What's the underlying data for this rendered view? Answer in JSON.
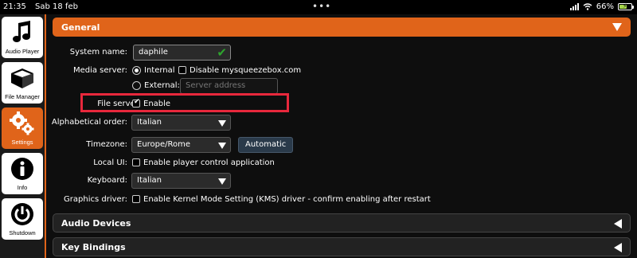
{
  "status": {
    "time": "21:35",
    "date": "Sab 18 feb",
    "battery": "66%",
    "battery_level": 0.66
  },
  "sidebar": {
    "items": [
      {
        "label": "Audio Player",
        "icon": "music-note-icon",
        "active": false
      },
      {
        "label": "File Manager",
        "icon": "drive-box-icon",
        "active": false
      },
      {
        "label": "Settings",
        "icon": "gears-icon",
        "active": true
      },
      {
        "label": "Info",
        "icon": "info-icon",
        "active": false
      },
      {
        "label": "Shutdown",
        "icon": "power-icon",
        "active": false
      }
    ]
  },
  "general": {
    "title": "General",
    "system_name_label": "System name:",
    "system_name_value": "daphile",
    "media_server_label": "Media server:",
    "internal_label": "Internal",
    "disable_mysqueezebox_label": "Disable mysqueezebox.com",
    "external_label": "External:",
    "server_address_placeholder": "Server address",
    "file_server_label": "File server:",
    "file_server_enable_label": "Enable",
    "alphabetical_order_label": "Alphabetical order:",
    "alphabetical_order_value": "Italian",
    "timezone_label": "Timezone:",
    "timezone_value": "Europe/Rome",
    "automatic_button": "Automatic",
    "local_ui_label": "Local UI:",
    "local_ui_option": "Enable player control application",
    "keyboard_label": "Keyboard:",
    "keyboard_value": "Italian",
    "graphics_driver_label": "Graphics driver:",
    "graphics_driver_option": "Enable Kernel Mode Setting (KMS) driver - confirm enabling after restart"
  },
  "sections": {
    "audio_devices": "Audio Devices",
    "key_bindings": "Key Bindings"
  },
  "colors": {
    "accent": "#e0641a",
    "highlight": "#e8283c",
    "ok": "#2ea52e"
  }
}
